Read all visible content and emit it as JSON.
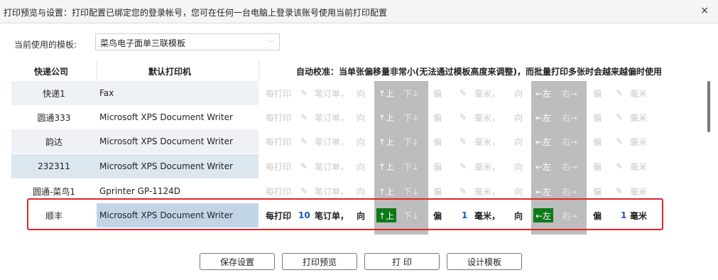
{
  "dialog": {
    "title": "打印预览与设置：打印配置已绑定您的登录帐号，您可在任何一台电脑上登录该账号使用当前打印配置",
    "close_symbol": "×"
  },
  "template": {
    "label": "当前使用的模板:",
    "value": "菜鸟电子面单三联模板",
    "chevron": "⌵"
  },
  "table": {
    "headers": {
      "company": "快递公司",
      "printer": "默认打印机",
      "calibration": "自动校准：当单张偏移量非常小(无法通过模板高度来调整)，而批量打印多张时会越来越偏时使用"
    },
    "tokens": {
      "every_print": "每打印",
      "orders": "笔订单，",
      "dir": "向",
      "up": "↑上",
      "down": "下↓",
      "offset": "偏",
      "mm_comma": "毫米，",
      "left": "←左",
      "right": "右→",
      "mm": "毫米",
      "pencil": "✎"
    },
    "rows": [
      {
        "company": "快递1",
        "printer": "Fax",
        "orders_value": "",
        "v_offset": "",
        "h_offset": ""
      },
      {
        "company": "圆通333",
        "printer": "Microsoft XPS Document Writer",
        "orders_value": "",
        "v_offset": "",
        "h_offset": ""
      },
      {
        "company": "韵达",
        "printer": "Microsoft XPS Document Writer",
        "orders_value": "",
        "v_offset": "",
        "h_offset": ""
      },
      {
        "company": "232311",
        "printer": "Microsoft XPS Document Writer",
        "orders_value": "",
        "v_offset": "",
        "h_offset": ""
      },
      {
        "company": "圆通-菜鸟1",
        "printer": "Gprinter GP-1124D",
        "orders_value": "",
        "v_offset": "",
        "h_offset": ""
      },
      {
        "company": "顺丰",
        "printer": "Microsoft XPS Document Writer",
        "orders_value": "10",
        "v_offset": "1",
        "h_offset": "1",
        "selected_up": true,
        "selected_left": true,
        "active": true
      }
    ]
  },
  "buttons": {
    "save": "保存设置",
    "preview": "打印预览",
    "print": "打 印",
    "design": "设计模板"
  },
  "colors": {
    "row_highlight": "#dbe6ef",
    "row_zebra": "#eef2f6",
    "active_row": "#c2d5e6",
    "accent_green": "#0d7a17",
    "highlight_border": "#e0252b"
  }
}
